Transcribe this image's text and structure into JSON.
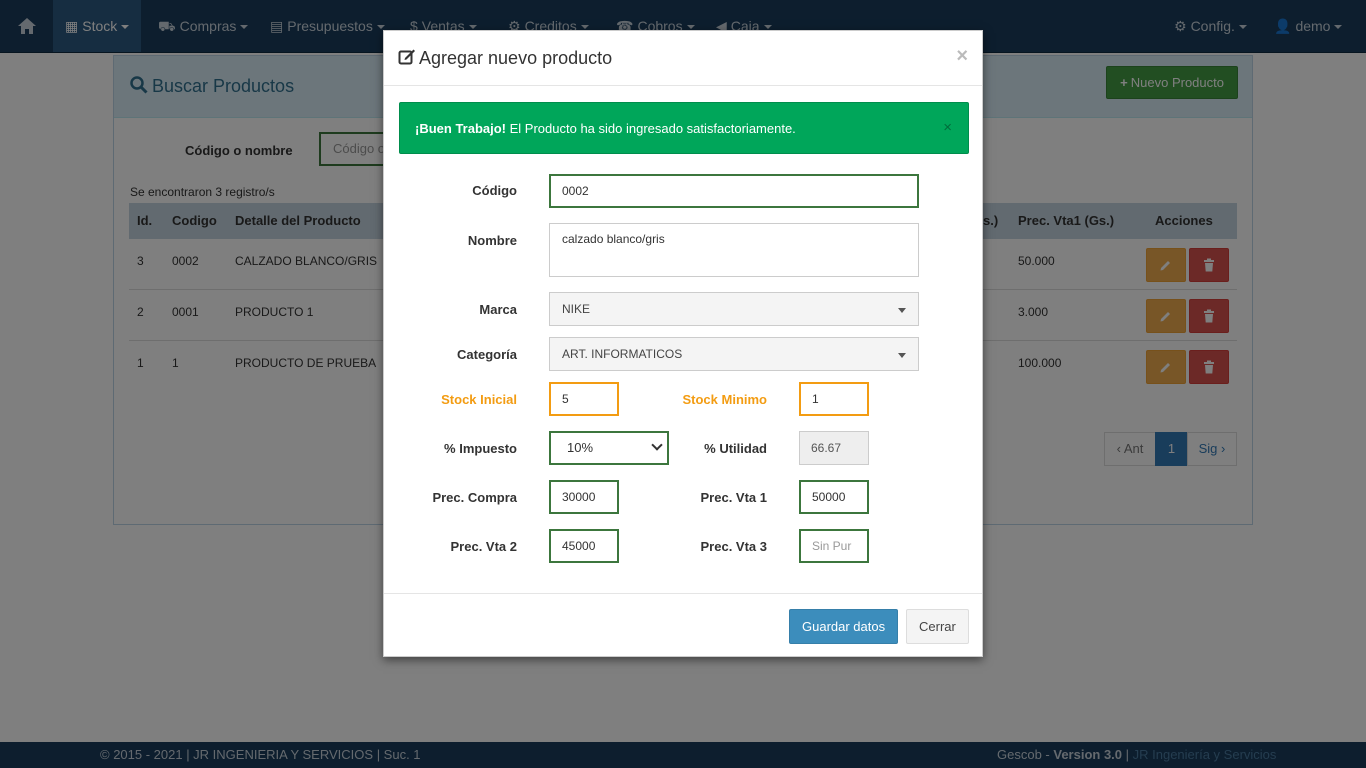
{
  "nav": {
    "items": [
      {
        "label": "Stock",
        "icon": "gift-icon"
      },
      {
        "label": "Compras",
        "icon": "cart-icon"
      },
      {
        "label": "Presupuestos",
        "icon": "calculator-icon"
      },
      {
        "label": "Ventas",
        "icon": "dollar-icon"
      },
      {
        "label": "Creditos",
        "icon": "gear-icon"
      },
      {
        "label": "Cobros",
        "icon": "phone-icon"
      },
      {
        "label": "Caja",
        "icon": "bullhorn-icon"
      }
    ],
    "config_label": "Config.",
    "user_label": "demo"
  },
  "panel": {
    "title": "Buscar Productos",
    "new_button": "Nuevo Producto",
    "search_label": "Código o nombre",
    "search_placeholder": "Código o",
    "records_text": "Se encontraron 3 registro/s",
    "columns": [
      "Id.",
      "Codigo",
      "Detalle del Producto",
      "s.)",
      "Prec. Vta1 (Gs.)",
      "Acciones"
    ],
    "rows": [
      {
        "id": "3",
        "codigo": "0002",
        "detalle": "CALZADO BLANCO/GRIS",
        "precio": "50.000"
      },
      {
        "id": "2",
        "codigo": "0001",
        "detalle": "PRODUCTO 1",
        "precio": "3.000"
      },
      {
        "id": "1",
        "codigo": "1",
        "detalle": "PRODUCTO DE PRUEBA",
        "precio": "100.000"
      }
    ],
    "pager": {
      "prev": "‹ Ant",
      "current": "1",
      "next": "Sig ›"
    }
  },
  "footer": {
    "left": "© 2015 - 2021 | JR INGENIERIA Y SERVICIOS | Suc. 1",
    "brand": "Gescob - ",
    "version": "Version 3.0",
    "separator": " | ",
    "company": "JR Ingeniería y Servicios"
  },
  "modal": {
    "title": "Agregar nuevo producto",
    "close": "×",
    "alert": {
      "strong": "¡Buen Trabajo!",
      "text": " El Producto ha sido ingresado satisfactoriamente.",
      "close": "×"
    },
    "fields": {
      "codigo": {
        "label": "Código",
        "value": "0002"
      },
      "nombre": {
        "label": "Nombre",
        "value": "calzado blanco/gris"
      },
      "marca": {
        "label": "Marca",
        "value": "NIKE"
      },
      "categoria": {
        "label": "Categoría",
        "value": "ART. INFORMATICOS"
      },
      "stock_inicial": {
        "label": "Stock Inicial",
        "value": "5"
      },
      "stock_minimo": {
        "label": "Stock Minimo",
        "value": "1"
      },
      "impuesto": {
        "label": "% Impuesto",
        "value": "10%"
      },
      "utilidad": {
        "label": "% Utilidad",
        "value": "66.67"
      },
      "prec_compra": {
        "label": "Prec. Compra",
        "value": "30000"
      },
      "prec_vta1": {
        "label": "Prec. Vta 1",
        "value": "50000"
      },
      "prec_vta2": {
        "label": "Prec. Vta 2",
        "value": "45000"
      },
      "prec_vta3": {
        "label": "Prec. Vta 3",
        "placeholder": "Sin Pur"
      }
    },
    "save_button": "Guardar datos",
    "close_button": "Cerrar"
  },
  "colors": {
    "navbar": "#1a3d5c",
    "success": "#00a65a",
    "primary": "#3c8dbc",
    "warning": "#f39c12",
    "valid_border": "#3c763d"
  }
}
